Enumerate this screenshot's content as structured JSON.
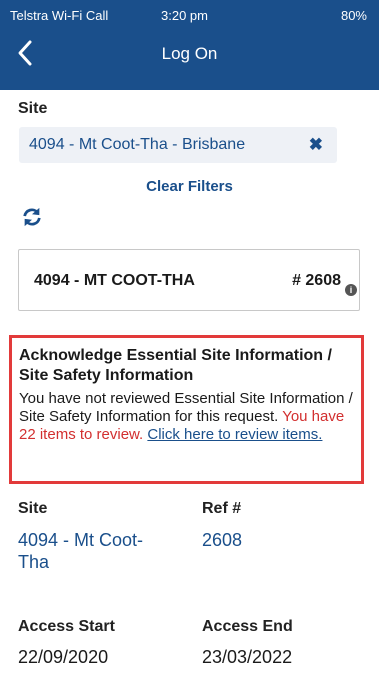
{
  "status": {
    "carrier": "Telstra Wi-Fi Call",
    "time": "3:20 pm",
    "battery": "80%"
  },
  "header": {
    "title": "Log On"
  },
  "site_filter": {
    "label": "Site",
    "value": "4094 - Mt Coot-Tha - Brisbane",
    "clear_label": "Clear Filters"
  },
  "card": {
    "site": "4094 - MT COOT-THA",
    "ref": "# 2608"
  },
  "alert": {
    "title": "Acknowledge Essential Site Information / Site Safety Information",
    "body": "You have not reviewed Essential Site Information / Site Safety Information for this request.",
    "count": "You have 22 items to review.",
    "link": "Click here to review items."
  },
  "details": {
    "site_label": "Site",
    "site_value": "4094 - Mt Coot-Tha",
    "ref_label": "Ref #",
    "ref_value": "2608",
    "start_label": "Access Start",
    "start_date": "22/09/2020",
    "end_label": "Access End",
    "end_date": "23/03/2022"
  },
  "colors": {
    "brand": "#1a4f8b",
    "alert_border": "#e23a3a",
    "alert_text": "#d22f2f"
  }
}
